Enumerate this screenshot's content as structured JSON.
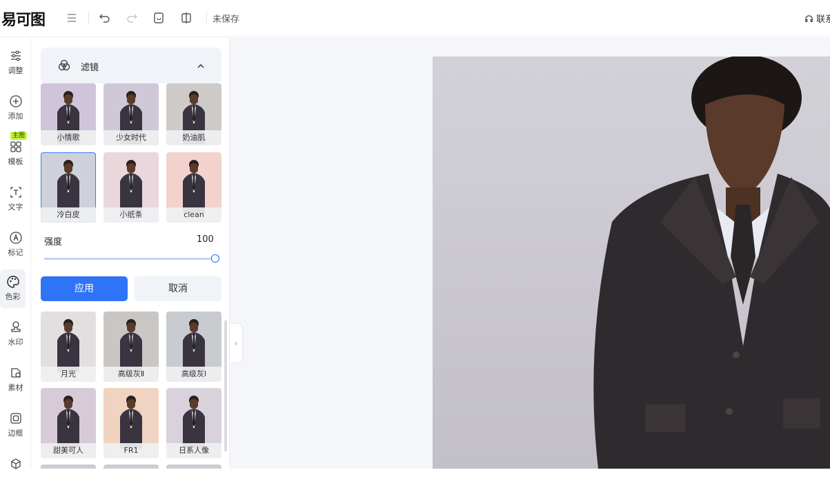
{
  "app": {
    "logo_text": "易可图",
    "save_status": "未保存",
    "contact_label": "联系"
  },
  "toolbar": {
    "icons": [
      "menu-icon",
      "undo-icon",
      "redo-icon",
      "history-icon",
      "compare-icon"
    ]
  },
  "sidebar": {
    "items": [
      {
        "label": "调整",
        "icon": "sliders-icon"
      },
      {
        "label": "添加",
        "icon": "plus-circle-icon"
      },
      {
        "label": "模板",
        "icon": "grid-icon",
        "badge": "主图"
      },
      {
        "label": "文字",
        "icon": "text-icon"
      },
      {
        "label": "标记",
        "icon": "marker-icon"
      },
      {
        "label": "色彩",
        "icon": "palette-icon",
        "active": true
      },
      {
        "label": "水印",
        "icon": "stamp-icon"
      },
      {
        "label": "素材",
        "icon": "material-icon"
      },
      {
        "label": "边框",
        "icon": "frame-icon"
      }
    ]
  },
  "panel": {
    "section_title": "滤镜",
    "filters_top": [
      {
        "label": "小情歌",
        "tint": "#cfc4d9"
      },
      {
        "label": "少女时代",
        "tint": "#cfc8d6"
      },
      {
        "label": "奶油肌",
        "tint": "#cdcac8"
      },
      {
        "label": "冷白皮",
        "tint": "#cfd1da",
        "selected": true
      },
      {
        "label": "小纸条",
        "tint": "#ead7dc"
      },
      {
        "label": "clean",
        "tint": "#f3d2cd"
      }
    ],
    "strength_label": "强度",
    "strength_value": "100",
    "strength": 100,
    "apply_label": "应用",
    "cancel_label": "取消",
    "filters_bottom": [
      {
        "label": "月光",
        "tint": "#e3dfe0"
      },
      {
        "label": "高级灰Ⅱ",
        "tint": "#c9c6c4"
      },
      {
        "label": "高级灰Ⅰ",
        "tint": "#c8ccd0"
      },
      {
        "label": "甜美可人",
        "tint": "#d7cbd8"
      },
      {
        "label": "FR1",
        "tint": "#f0d3c0"
      },
      {
        "label": "日系人像",
        "tint": "#d9d2dc"
      }
    ]
  },
  "colors": {
    "accent": "#2f74f6",
    "badge": "#c6f23a"
  }
}
